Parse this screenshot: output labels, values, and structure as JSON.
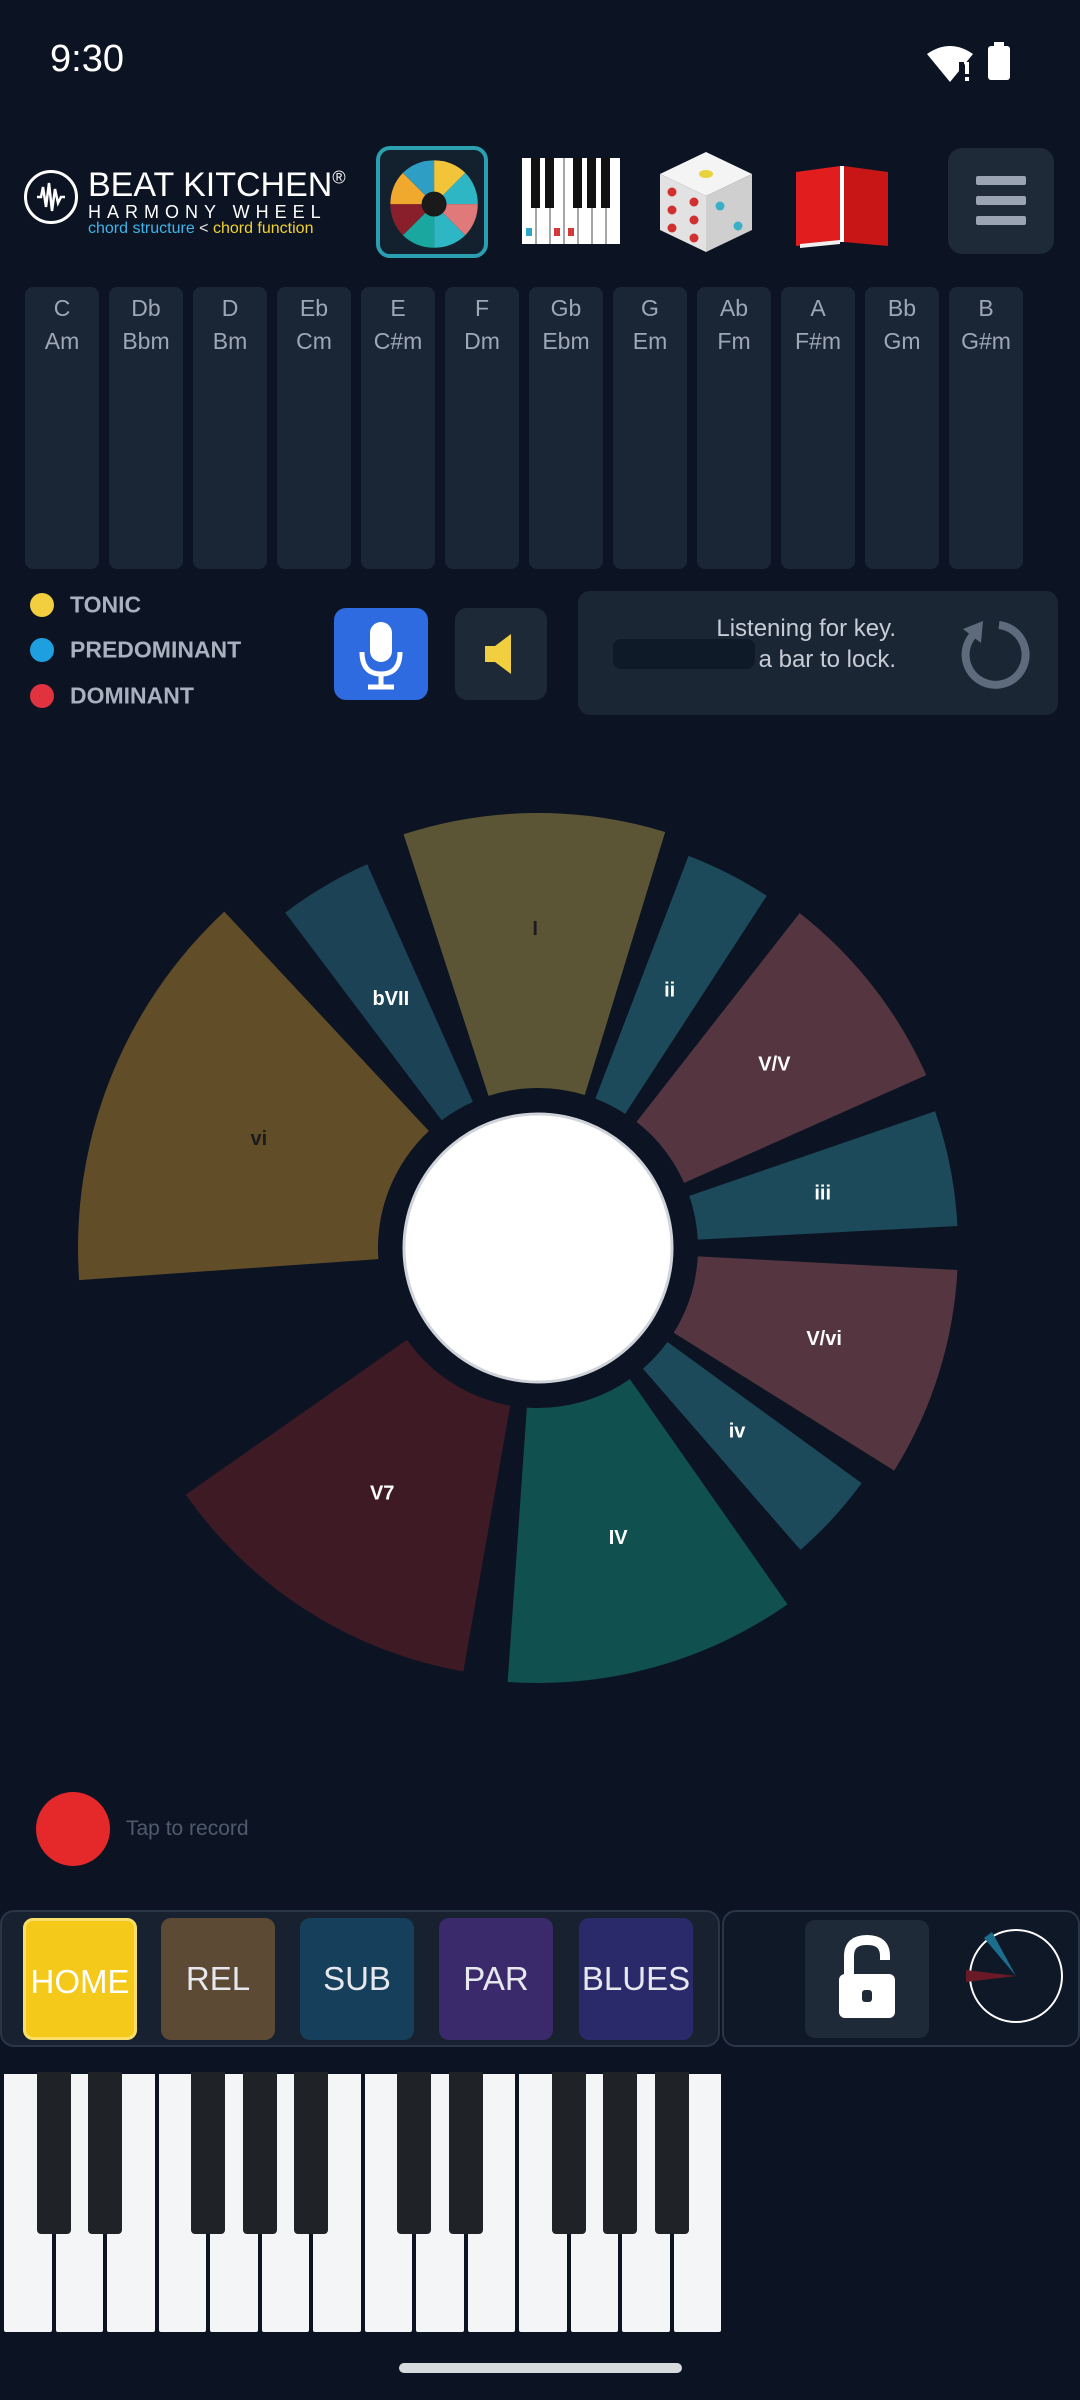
{
  "status_bar": {
    "time": "9:30"
  },
  "header": {
    "logo": {
      "title": "BEAT KITCHEN",
      "registered": "®",
      "subtitle": "HARMONY WHEEL",
      "tag_left": "chord structure",
      "tag_sep": " < ",
      "tag_right": "chord function"
    },
    "tools": [
      "harmony-wheel-icon",
      "piano-icon",
      "dice-icon",
      "book-icon"
    ],
    "menu_icon": "hamburger-menu-icon"
  },
  "keys": [
    {
      "major": "C",
      "minor": "Am"
    },
    {
      "major": "Db",
      "minor": "Bbm"
    },
    {
      "major": "D",
      "minor": "Bm"
    },
    {
      "major": "Eb",
      "minor": "Cm"
    },
    {
      "major": "E",
      "minor": "C#m"
    },
    {
      "major": "F",
      "minor": "Dm"
    },
    {
      "major": "Gb",
      "minor": "Ebm"
    },
    {
      "major": "G",
      "minor": "Em"
    },
    {
      "major": "Ab",
      "minor": "Fm"
    },
    {
      "major": "A",
      "minor": "F#m"
    },
    {
      "major": "Bb",
      "minor": "Gm"
    },
    {
      "major": "B",
      "minor": "G#m"
    }
  ],
  "legend": [
    {
      "label": "TONIC",
      "color": "#f2cf3e"
    },
    {
      "label": "PREDOMINANT",
      "color": "#1ea0e0"
    },
    {
      "label": "DOMINANT",
      "color": "#e0333f"
    }
  ],
  "listening": {
    "line1": "Listening for key.",
    "line2": "a bar to lock."
  },
  "wheel": {
    "segments": [
      {
        "label": "I",
        "color": "#5c5535",
        "text_color": "#1b1b1b"
      },
      {
        "label": "ii",
        "color": "#1c4a5a",
        "text_color": "#ffffff"
      },
      {
        "label": "V/V",
        "color": "#553540",
        "text_color": "#ffffff"
      },
      {
        "label": "iii",
        "color": "#1c4a5a",
        "text_color": "#ffffff"
      },
      {
        "label": "V/vi",
        "color": "#553540",
        "text_color": "#ffffff"
      },
      {
        "label": "iv",
        "color": "#1c4a5a",
        "text_color": "#ffffff"
      },
      {
        "label": "IV",
        "color": "#10504e",
        "text_color": "#ffffff"
      },
      {
        "label": "V7",
        "color": "#3e1a25",
        "text_color": "#ffffff"
      },
      {
        "label": "vi",
        "color": "#614d28",
        "text_color": "#1b1b1b"
      },
      {
        "label": "bVII",
        "color": "#1c4255",
        "text_color": "#ffffff"
      }
    ]
  },
  "record": {
    "label": "Tap to record"
  },
  "modes": [
    {
      "id": "home",
      "label": "HOME"
    },
    {
      "id": "rel",
      "label": "REL"
    },
    {
      "id": "sub",
      "label": "SUB"
    },
    {
      "id": "par",
      "label": "PAR"
    },
    {
      "id": "blues",
      "label": "BLUES"
    }
  ]
}
